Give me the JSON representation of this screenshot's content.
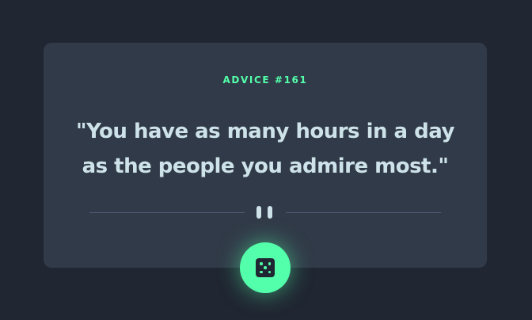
{
  "card": {
    "advice_label": "ADVICE #161",
    "quote": "\"You have as many hours in a day as the people you admire most.\""
  },
  "divider": {
    "icon": "pause-icon"
  },
  "button": {
    "icon": "dice-icon",
    "color": "#53ffaa"
  },
  "colors": {
    "background": "#202632",
    "card": "#313a48",
    "accent": "#53ffaa",
    "text": "#cee3e9"
  }
}
